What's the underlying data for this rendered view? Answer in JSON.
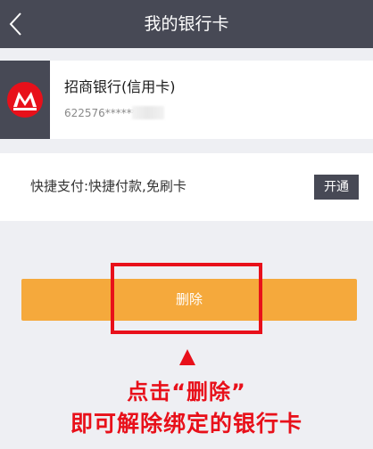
{
  "header": {
    "title": "我的银行卡",
    "back_icon": "chevron-left-icon"
  },
  "card": {
    "bank_name": "招商银行(信用卡)",
    "card_number": "622576******",
    "logo_icon": "cmb-bank-logo",
    "logo_color": "#e8101a"
  },
  "quickpay": {
    "label": "快捷支付:快捷付款,免刷卡",
    "button_label": "开通"
  },
  "actions": {
    "delete_label": "删除"
  },
  "annotation": {
    "line1": "点击“删除”",
    "line2": "即可解除绑定的银行卡",
    "color": "#e8101a"
  },
  "colors": {
    "nav_bg": "#474955",
    "page_bg": "#eeeff3",
    "delete_bg": "#f5a93c"
  }
}
